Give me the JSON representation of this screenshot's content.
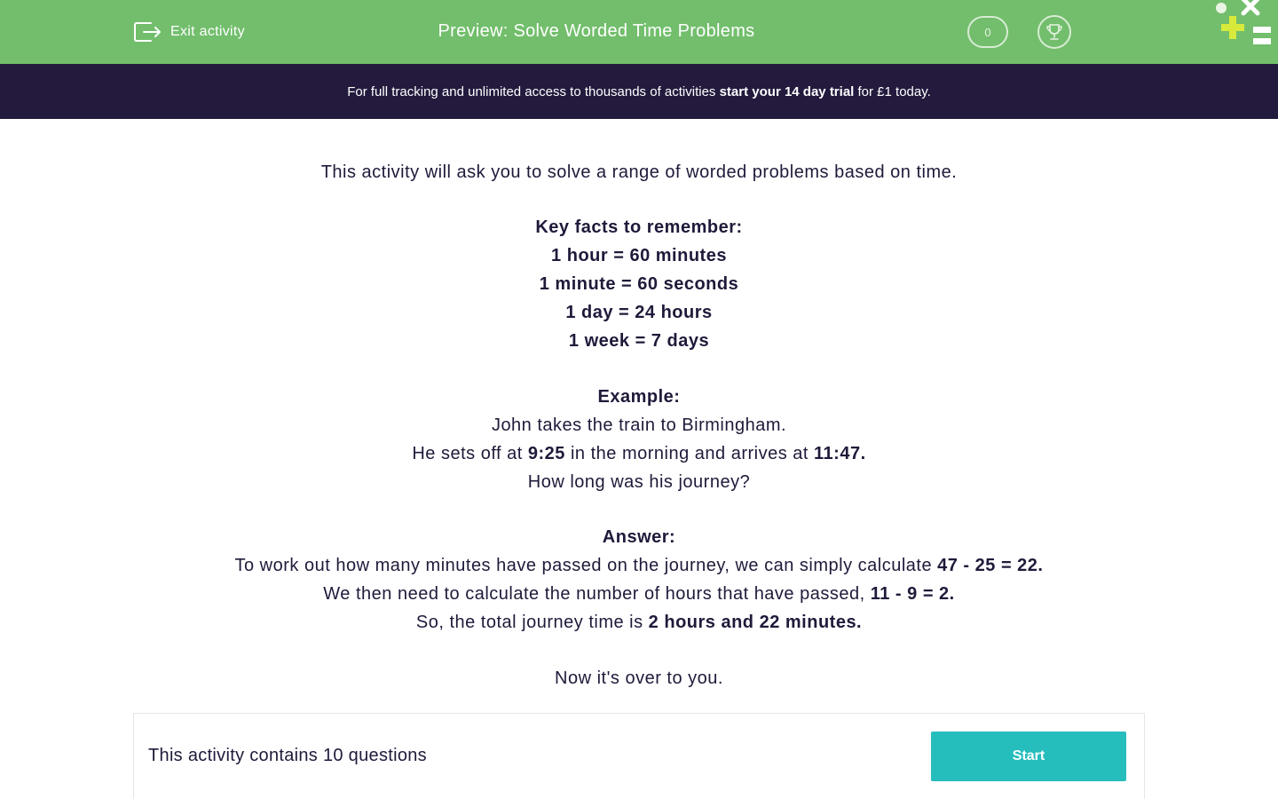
{
  "header": {
    "exit_label": "Exit activity",
    "exit_icon": "exit-icon",
    "title": "Preview: Solve Worded Time Problems",
    "score": "0",
    "trophy_icon": "trophy-icon",
    "logo_icon": "math-symbols-logo",
    "bg_color": "#72be6c"
  },
  "banner": {
    "text_before": "For full tracking and unlimited access to thousands of activities ",
    "text_bold": "start your 14 day trial",
    "text_after": " for £1 today.",
    "bg_color": "#231a3d"
  },
  "intro": "This activity will ask you to solve a range of worded problems based on time.",
  "key_facts": {
    "heading": "Key facts to remember:",
    "facts": [
      "1 hour = 60 minutes",
      "1 minute = 60 seconds",
      "1 day = 24 hours",
      "1 week = 7 days"
    ]
  },
  "example": {
    "heading": "Example:",
    "line1": "John takes the train to Birmingham.",
    "line2_a": "He sets off at ",
    "line2_b": "9:25",
    "line2_c": " in the morning and arrives at ",
    "line2_d": "11:47.",
    "line3": "How long was his journey?"
  },
  "answer": {
    "heading": "Answer:",
    "line1_a": "To work out how many minutes have passed on the journey, we can simply calculate ",
    "line1_b": "47 - 25 = 22.",
    "line2_a": "We then need to calculate the number of hours that have passed, ",
    "line2_b": "11 - 9 = 2.",
    "line3_a": "So, the total journey time is ",
    "line3_b": "2 hours and 22 minutes."
  },
  "closing": "Now it's over to you.",
  "footer": {
    "questions_text": "This activity contains 10 questions",
    "start_label": "Start",
    "start_color": "#26bdbd"
  }
}
